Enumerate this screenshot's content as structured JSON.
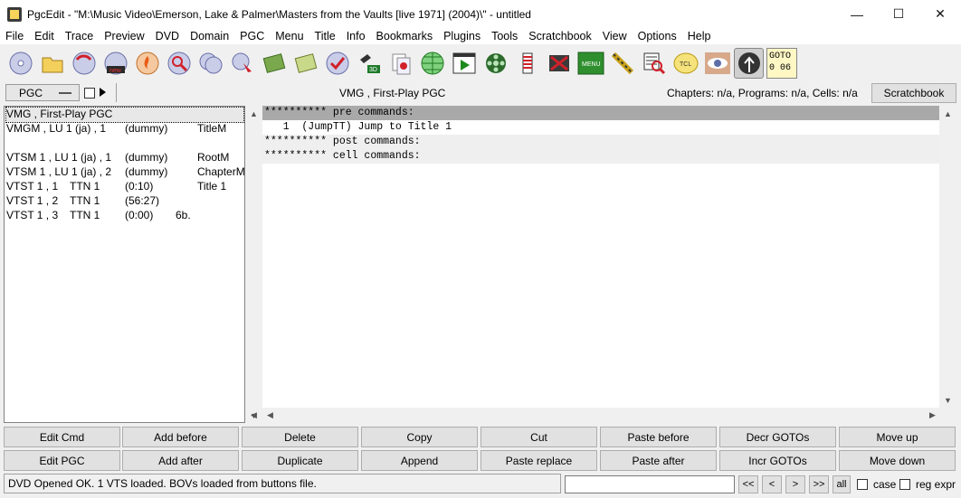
{
  "window": {
    "title": "PgcEdit -   \"M:\\Music Video\\Emerson, Lake & Palmer\\Masters from the Vaults [live 1971] (2004)\\\" - untitled",
    "minimize": "—",
    "maximize": "☐",
    "close": "✕"
  },
  "menu": [
    "File",
    "Edit",
    "Trace",
    "Preview",
    "DVD",
    "Domain",
    "PGC",
    "Menu",
    "Title",
    "Info",
    "Bookmarks",
    "Plugins",
    "Tools",
    "Scratchbook",
    "View",
    "Options",
    "Help"
  ],
  "toolbar": {
    "icons": [
      "disc-icon",
      "open-folder-icon",
      "reload-disc-icon",
      "new-disc-icon",
      "burn-icon",
      "search-disc-icon",
      "dual-disc-icon",
      "disc-bookmark-icon",
      "play-green-icon",
      "play-green-next-icon",
      "disc-check-icon",
      "3d-icon",
      "copy-doc-icon",
      "globe-icon",
      "film-play-icon",
      "film-reel-icon",
      "bookmark-list-icon",
      "film-cut-icon",
      "menu-icon",
      "chain-icon",
      "hex-search-icon",
      "tcl-icon",
      "eye-icon",
      "navigate-icon"
    ],
    "menu_label": "MENU",
    "tcl_label": "TCL",
    "goto_label": "GOTO",
    "goto_value": "0 06"
  },
  "pgc_bar": {
    "selector": "PGC",
    "caption": "VMG , First-Play PGC",
    "info": "Chapters: n/a,  Programs: n/a,  Cells: n/a",
    "scratchbook": "Scratchbook"
  },
  "pgc_list": [
    {
      "a": "VMG , First-Play PGC",
      "b": "",
      "c": "",
      "d": "",
      "selected": true
    },
    {
      "a": "VMGM , LU 1 (ja) , 1",
      "b": "",
      "c": "(dummy)",
      "d": "TitleM"
    },
    {
      "a": "",
      "b": "",
      "c": "",
      "d": ""
    },
    {
      "a": "VTSM 1 , LU 1 (ja) , 1",
      "b": "",
      "c": "(dummy)",
      "d": "RootM"
    },
    {
      "a": "VTSM 1 , LU 1 (ja) , 2",
      "b": "",
      "c": "(dummy)",
      "d": "ChapterM"
    },
    {
      "a": "VTST 1 , 1",
      "b": "TTN 1",
      "c": "(0:10)",
      "d": "Title 1"
    },
    {
      "a": "VTST 1 , 2",
      "b": "TTN 1",
      "c": "(56:27)",
      "d": ""
    },
    {
      "a": "VTST 1 , 3",
      "b": "TTN 1",
      "c": "(0:00)",
      "d": "6b."
    }
  ],
  "commands": [
    "********** pre commands:",
    "   1  (JumpTT) Jump to Title 1",
    "********** post commands:",
    "********** cell commands:"
  ],
  "buttons_row1": [
    "Edit Cmd",
    "Add before",
    "Delete",
    "Copy",
    "Cut",
    "Paste before",
    "Decr GOTOs",
    "Move up"
  ],
  "buttons_row2": [
    "Edit PGC",
    "Add after",
    "Duplicate",
    "Append",
    "Paste replace",
    "Paste after",
    "Incr GOTOs",
    "Move down"
  ],
  "status": {
    "text": "DVD Opened OK.  1 VTS loaded.  BOVs loaded from buttons file.",
    "find_value": "",
    "nav": [
      "<<",
      "<",
      ">",
      ">>"
    ],
    "all": "all",
    "case": "case",
    "regexpr": "reg expr"
  }
}
